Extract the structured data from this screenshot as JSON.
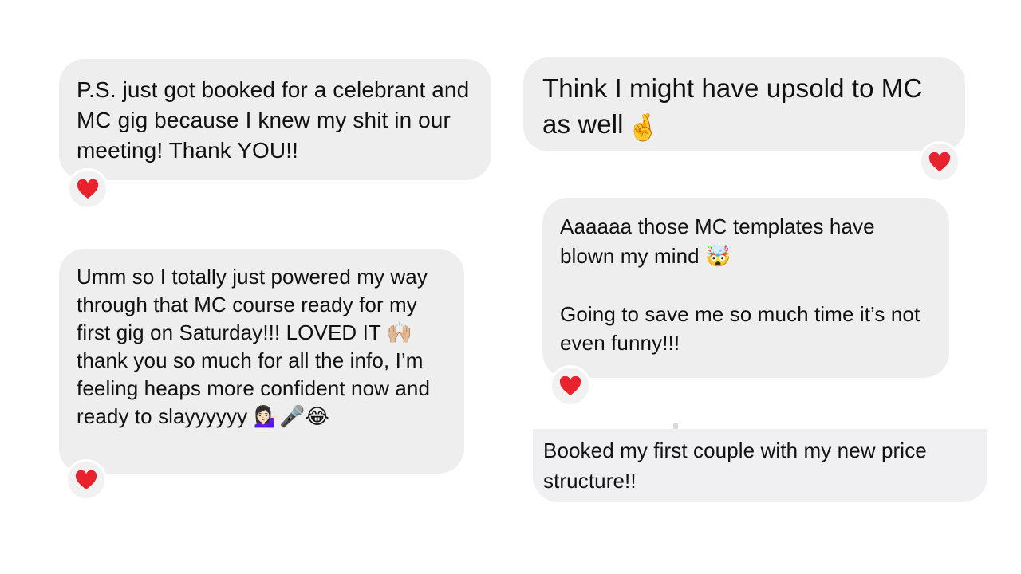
{
  "messages": [
    {
      "text": "P.S. just got booked for a celebrant and MC gig because I knew my shit in our meeting! Thank YOU!!",
      "reaction": "heart-icon"
    },
    {
      "text": "Think I might have upsold to MC as well",
      "emoji": "🤞",
      "reaction": "heart-icon"
    },
    {
      "text": "Umm so I totally just powered my way through that MC course ready for my first gig on Saturday!!! LOVED IT 🙌🏼 thank you so much for all the info, I’m feeling heaps more confident now and ready to slayyyyyy 💁🏻‍♀️🎤😂",
      "reaction": "heart-icon"
    },
    {
      "text": "Aaaaaa those MC templates have blown my mind 🤯\n\nGoing to save me so much time it’s not even funny!!!",
      "reaction": "heart-icon"
    },
    {
      "text": "Booked my first couple with my new price structure!!"
    }
  ],
  "colors": {
    "bubble": "#eeeeef",
    "heart": "#e8232e",
    "background": "#ffffff"
  }
}
